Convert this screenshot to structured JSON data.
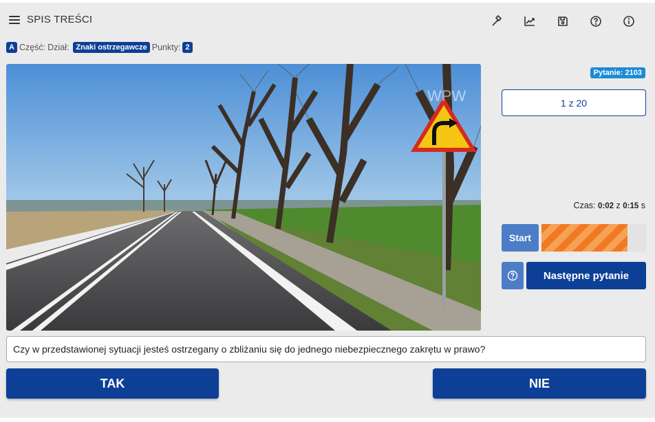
{
  "header": {
    "title": "SPIS TREŚCI",
    "tools": [
      {
        "icon": "hammer-icon"
      },
      {
        "icon": "chart-trend-icon"
      },
      {
        "icon": "floppy-disk-icon"
      },
      {
        "icon": "help-circle-icon"
      },
      {
        "icon": "info-icon"
      }
    ]
  },
  "meta": {
    "category": "A",
    "part_label": "Część:",
    "section_label": "Dział:",
    "section_value": "Znaki ostrzegawcze",
    "points_label": "Punkty:",
    "points_value": "2"
  },
  "photo": {
    "watermark": "WPW"
  },
  "panel": {
    "question_id": "Pytanie: 2103",
    "counter": "1 z 20",
    "timer_label": "Czas:",
    "time_elapsed": "0:02",
    "timer_of": "z",
    "time_total": "0:15",
    "timer_unit": "s",
    "progress_fraction": 0.82,
    "start_label": "Start",
    "next_label": "Następne pytanie"
  },
  "question": {
    "text": "Czy w przedstawionej sytuacji jesteś ostrzegany o zbliżaniu się do jednego niebezpiecznego zakrętu w prawo?"
  },
  "answers": {
    "yes_label": "TAK",
    "no_label": "NIE"
  },
  "colors": {
    "primary": "#0d3f96",
    "accent_blue": "#4e7dc7",
    "badge_blue": "#1a8bd6",
    "progress_orange": "#f07a22"
  }
}
